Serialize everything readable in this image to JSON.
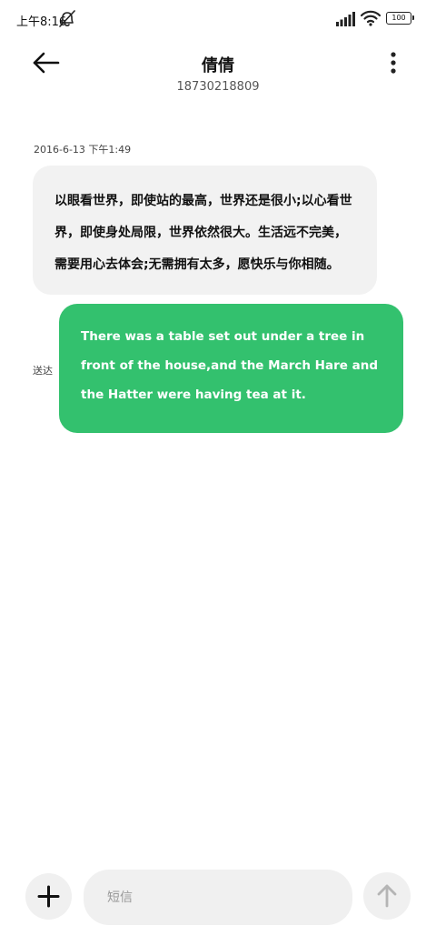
{
  "status_bar": {
    "time": "上午8:16",
    "battery": "100",
    "icons": [
      "mute-notification-icon",
      "signal-icon",
      "wifi-icon",
      "battery-icon"
    ]
  },
  "header": {
    "contact_name": "倩倩",
    "contact_number": "18730218809",
    "icons": [
      "back-arrow-icon",
      "more-vertical-icon"
    ]
  },
  "conversation": {
    "timestamp": "2016-6-13 下午1:49",
    "incoming_message": "以眼看世界，即使站的最高，世界还是很小;以心看世界，即使身处局限，世界依然很大。生活远不完美，需要用心去体会;无需拥有太多，愿快乐与你相随。",
    "outgoing_message": "There was a table set out under a tree in front of the house,and the March Hare and the Hatter were having tea at it.",
    "delivery_status": "送达",
    "colors": {
      "incoming_bubble": "#f2f2f2",
      "outgoing_bubble": "#33c16e"
    }
  },
  "compose": {
    "placeholder": "短信",
    "value": "",
    "icons": [
      "plus-icon",
      "send-arrow-icon"
    ]
  }
}
